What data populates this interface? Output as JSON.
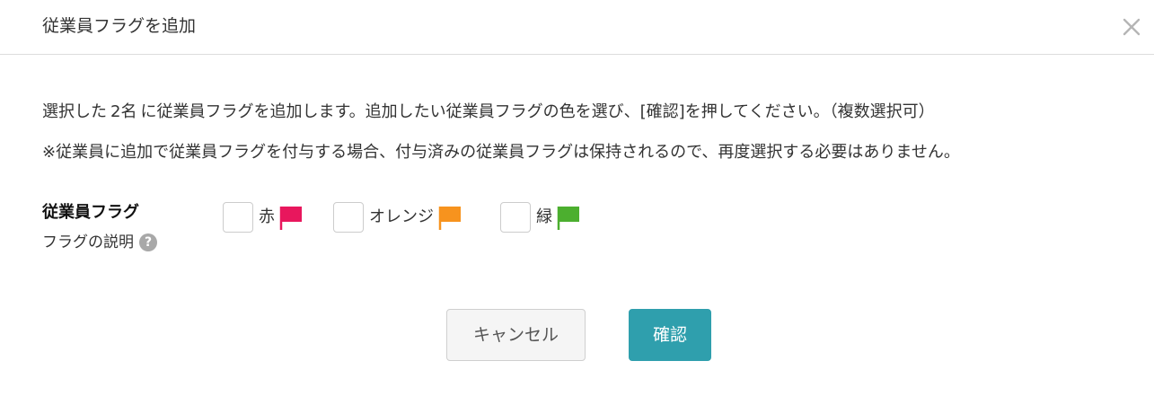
{
  "dialog": {
    "title": "従業員フラグを追加",
    "close_icon": "close-icon"
  },
  "message": {
    "line1_prefix": "選択した",
    "count": "2名",
    "line1_suffix": "に従業員フラグを追加します。追加したい従業員フラグの色を選び、[確認]を押してください。（複数選択可）",
    "line2": "※従業員に追加で従業員フラグを付与する場合、付与済みの従業員フラグは保持されるので、再度選択する必要はありません。"
  },
  "field": {
    "label": "従業員フラグ",
    "help_text": "フラグの説明",
    "help_icon": "question-circle-icon",
    "help_glyph": "?"
  },
  "flags": [
    {
      "label": "赤",
      "color": "#e8175d",
      "icon": "flag-icon"
    },
    {
      "label": "オレンジ",
      "color": "#f7931e",
      "icon": "flag-icon"
    },
    {
      "label": "緑",
      "color": "#4caf2f",
      "icon": "flag-icon"
    }
  ],
  "buttons": {
    "cancel": "キャンセル",
    "confirm": "確認"
  },
  "colors": {
    "accent": "#2f9fad",
    "flag_red": "#e8175d",
    "flag_orange": "#f7931e",
    "flag_green": "#4caf2f"
  }
}
